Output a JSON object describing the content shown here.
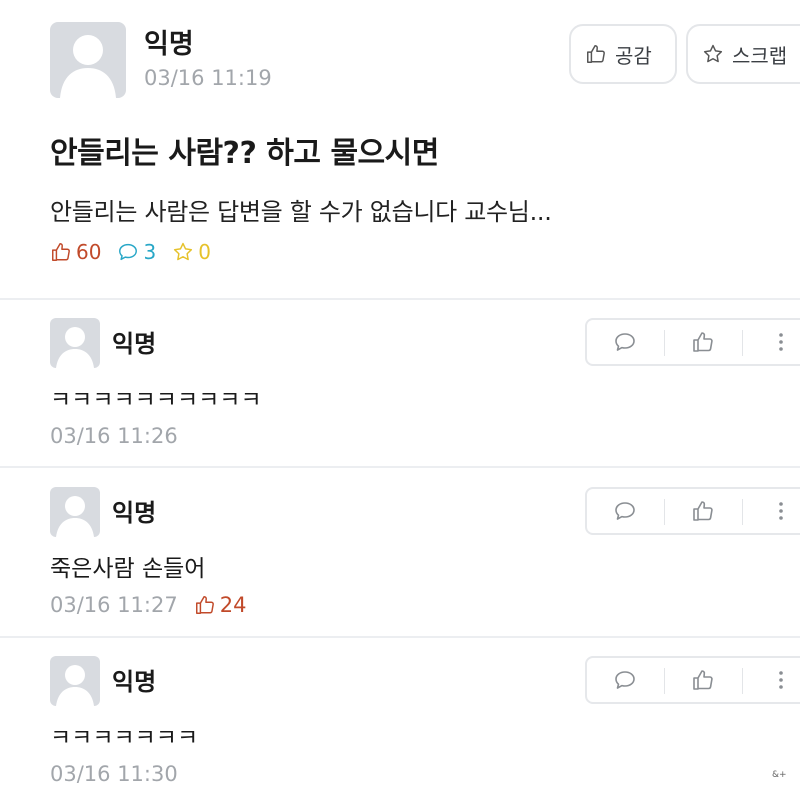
{
  "post": {
    "author": "익명",
    "time": "03/16 11:19",
    "like_label": "공감",
    "scrap_label": "스크랩",
    "title": "안들리는 사람?? 하고 물으시면",
    "body": "안들리는 사람은 답변을 할 수가 없습니다 교수님...",
    "likes": "60",
    "comments": "3",
    "scraps": "0"
  },
  "comments": [
    {
      "author": "익명",
      "text": "ㅋㅋㅋㅋㅋㅋㅋㅋㅋㅋ",
      "time": "03/16 11:26"
    },
    {
      "author": "익명",
      "text": "죽은사람 손들어",
      "time": "03/16 11:27",
      "likes": "24"
    },
    {
      "author": "익명",
      "text": "ㅋㅋㅋㅋㅋㅋㅋ",
      "time": "03/16 11:30"
    }
  ],
  "watermark": "&+",
  "colors": {
    "like": "#c14a2a",
    "comment": "#28a7c7",
    "scrap": "#e6c22b",
    "meta": "#a2a6ab"
  }
}
